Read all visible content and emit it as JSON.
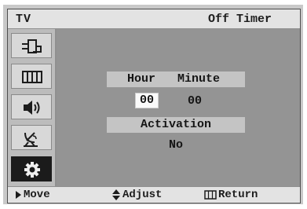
{
  "header": {
    "source": "TV",
    "title": "Off Timer"
  },
  "sidebar": {
    "items": [
      {
        "icon": "input-plug-icon",
        "active": false
      },
      {
        "icon": "picture-icon",
        "active": false
      },
      {
        "icon": "speaker-icon",
        "active": false
      },
      {
        "icon": "antenna-icon",
        "active": false
      },
      {
        "icon": "gear-icon",
        "active": true
      }
    ]
  },
  "timer": {
    "hour_label": "Hour",
    "minute_label": "Minute",
    "hour_value": "00",
    "minute_value": "00",
    "activation_label": "Activation",
    "activation_value": "No"
  },
  "footer": {
    "move_label": "Move",
    "adjust_label": "Adjust",
    "return_label": "Return"
  },
  "colors": {
    "panel": "#909090",
    "bar": "#e3e3e3",
    "active_icon_bg": "#1b1b1b"
  }
}
